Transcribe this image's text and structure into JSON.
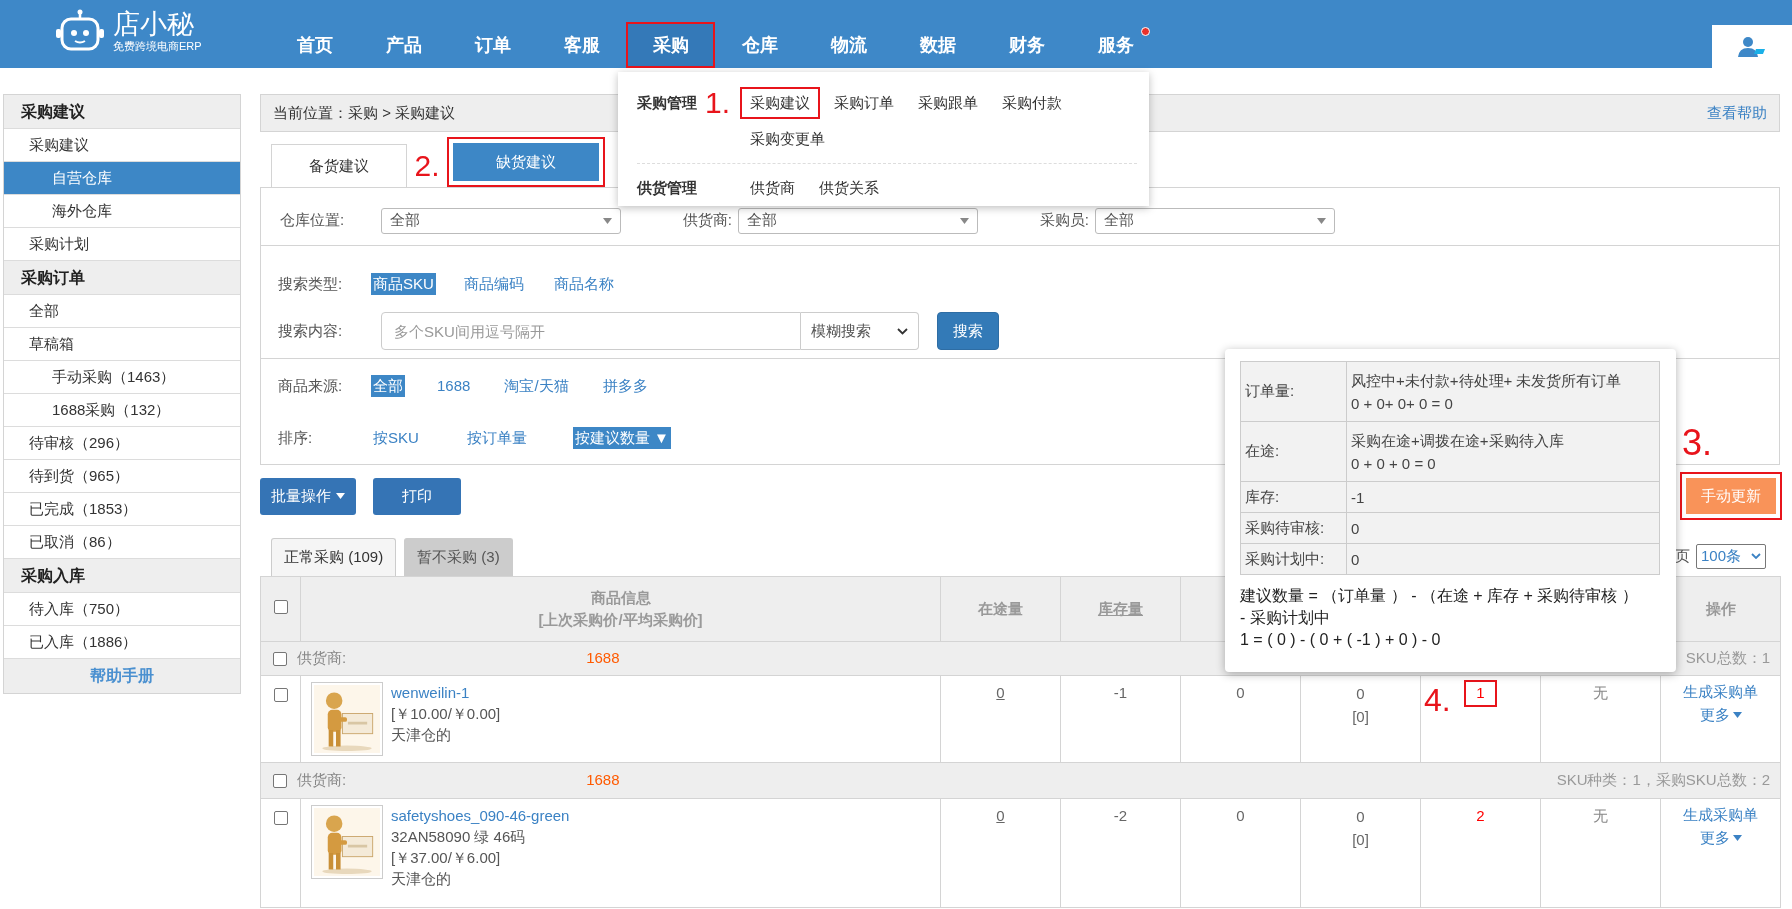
{
  "header": {
    "logo": {
      "title": "店小秘",
      "subtitle": "免费跨境电商ERP"
    },
    "nav": [
      {
        "label": "首页",
        "selected": false,
        "annotated": false,
        "notification_dot": false
      },
      {
        "label": "产品",
        "selected": false,
        "annotated": false,
        "notification_dot": false
      },
      {
        "label": "订单",
        "selected": false,
        "annotated": false,
        "notification_dot": false
      },
      {
        "label": "客服",
        "selected": false,
        "annotated": false,
        "notification_dot": false
      },
      {
        "label": "采购",
        "selected": true,
        "annotated": true,
        "notification_dot": false
      },
      {
        "label": "仓库",
        "selected": false,
        "annotated": false,
        "notification_dot": false
      },
      {
        "label": "物流",
        "selected": false,
        "annotated": false,
        "notification_dot": false
      },
      {
        "label": "数据",
        "selected": false,
        "annotated": false,
        "notification_dot": false
      },
      {
        "label": "财务",
        "selected": false,
        "annotated": false,
        "notification_dot": false
      },
      {
        "label": "服务",
        "selected": false,
        "annotated": false,
        "notification_dot": true
      }
    ]
  },
  "purchase_menu": {
    "groups": [
      {
        "title": "采购管理",
        "marker": "1.",
        "items": [
          {
            "label": "采购建议",
            "annotated": true
          },
          {
            "label": "采购订单",
            "annotated": false
          },
          {
            "label": "采购跟单",
            "annotated": false
          },
          {
            "label": "采购付款",
            "annotated": false
          },
          {
            "label": "采购变更单",
            "annotated": false
          }
        ]
      },
      {
        "title": "供货管理",
        "items": [
          {
            "label": "供货商",
            "annotated": false
          },
          {
            "label": "供货关系",
            "annotated": false
          }
        ]
      }
    ]
  },
  "sidebar": {
    "sections": [
      {
        "title": "采购建议",
        "items": [
          {
            "label": "采购建议",
            "selected": false,
            "children": [
              {
                "label": "自营仓库",
                "selected": true
              },
              {
                "label": "海外仓库",
                "selected": false
              }
            ]
          },
          {
            "label": "采购计划",
            "selected": false
          }
        ]
      },
      {
        "title": "采购订单",
        "items": [
          {
            "label": "全部",
            "selected": false
          },
          {
            "label": "草稿箱",
            "selected": false,
            "children": [
              {
                "label": "手动采购（1463）",
                "selected": false
              },
              {
                "label": "1688采购（132）",
                "selected": false
              }
            ]
          },
          {
            "label": "待审核（296）",
            "selected": false
          },
          {
            "label": "待到货（965）",
            "selected": false
          },
          {
            "label": "已完成（1853）",
            "selected": false
          },
          {
            "label": "已取消（86）",
            "selected": false
          }
        ]
      },
      {
        "title": "采购入库",
        "items": [
          {
            "label": "待入库（750）",
            "selected": false
          },
          {
            "label": "已入库（1886）",
            "selected": false
          }
        ]
      }
    ],
    "help_link": "帮助手册"
  },
  "breadcrumb": {
    "text": "当前位置：采购 > 采购建议",
    "help_link": "查看帮助"
  },
  "suggestion_tabs": [
    {
      "label": "备货建议",
      "selected": false,
      "annotated": false
    },
    {
      "label": "缺货建议",
      "selected": true,
      "annotated": true,
      "marker": "2."
    }
  ],
  "filters": {
    "selects": [
      {
        "label": "仓库位置:",
        "value": "全部"
      },
      {
        "label": "供货商:",
        "value": "全部"
      },
      {
        "label": "采购员:",
        "value": "全部"
      }
    ],
    "search_type": {
      "label": "搜索类型:",
      "options": [
        {
          "label": "商品SKU",
          "selected": true
        },
        {
          "label": "商品编码",
          "selected": false
        },
        {
          "label": "商品名称",
          "selected": false
        }
      ]
    },
    "search": {
      "label": "搜索内容:",
      "placeholder": "多个SKU间用逗号隔开",
      "mode": "模糊搜索",
      "button": "搜索"
    },
    "source": {
      "label": "商品来源:",
      "options": [
        {
          "label": "全部",
          "selected": true
        },
        {
          "label": "1688",
          "selected": false
        },
        {
          "label": "淘宝/天猫",
          "selected": false
        },
        {
          "label": "拼多多",
          "selected": false
        }
      ]
    },
    "sort": {
      "label": "排序:",
      "options": [
        {
          "label": "按SKU",
          "selected": false
        },
        {
          "label": "按订单量",
          "selected": false
        },
        {
          "label": "按建议数量 ▼",
          "selected": true
        }
      ]
    }
  },
  "toolbar": {
    "batch": "批量操作",
    "print": "打印",
    "refresh": {
      "label": "手动更新",
      "annotated": true,
      "marker": "3."
    }
  },
  "list_tabs": [
    {
      "label": "正常采购 (109)",
      "selected": true
    },
    {
      "label": "暂不采购 (3)",
      "selected": false
    }
  ],
  "page_size": {
    "label": "页",
    "value": "100条"
  },
  "table": {
    "select_all_checked": false,
    "columns": {
      "product": {
        "label": "商品信息",
        "sublabel": "[上次采购价/平均采购价]",
        "sortable": false
      },
      "in_transit": {
        "label": "在途量",
        "sortable": false
      },
      "stock": {
        "label": "库存量",
        "sortable": true
      },
      "action": {
        "label": "操作",
        "sortable": false
      }
    },
    "groups": [
      {
        "checked": false,
        "supplier_label": "供货商:",
        "supplier": "1688",
        "summary": "SKU总数：1",
        "rows": [
          {
            "checked": false,
            "kind": "picture",
            "sku": "wenweilin-1",
            "details": [
              "[￥10.00/￥0.00]",
              "天津仓的"
            ],
            "in_transit": "0",
            "stock": "-1",
            "column_4": "0",
            "column_5": [
              "0",
              "[0]"
            ],
            "suggested": {
              "value": "1",
              "annotated": true,
              "marker": "4."
            },
            "column_7": "无",
            "actions": [
              {
                "label": "生成采购单",
                "dropdown": false
              },
              {
                "label": "更多",
                "dropdown": true
              }
            ]
          }
        ]
      },
      {
        "checked": false,
        "supplier_label": "供货商:",
        "supplier": "1688",
        "summary": "SKU种类：1，采购SKU总数：2",
        "rows": [
          {
            "checked": false,
            "kind": "picture",
            "sku": "safetyshoes_090-46-green",
            "details": [
              "32AN58090 绿 46码",
              "[￥37.00/￥6.00]",
              "天津仓的"
            ],
            "in_transit": "0",
            "stock": "-2",
            "column_4": "0",
            "column_5": [
              "0",
              "[0]"
            ],
            "suggested": {
              "value": "2",
              "annotated": false
            },
            "column_7": "无",
            "actions": [
              {
                "label": "生成采购单",
                "dropdown": false
              },
              {
                "label": "更多",
                "dropdown": true
              }
            ]
          }
        ]
      }
    ]
  },
  "tooltip": {
    "rows": [
      {
        "label": "订单量:",
        "lines": [
          "风控中+未付款+待处理+ 未发货所有订单",
          "0 + 0+ 0+ 0 = 0"
        ]
      },
      {
        "label": "在途:",
        "lines": [
          "采购在途+调拨在途+采购待入库",
          "0 + 0 + 0 = 0"
        ]
      },
      {
        "label": "库存:",
        "lines": [
          "-1"
        ]
      },
      {
        "label": "采购待审核:",
        "lines": [
          "0"
        ]
      },
      {
        "label": "采购计划中:",
        "lines": [
          "0"
        ]
      }
    ],
    "formula": [
      "建议数量 = （订单量 ） - （在途 + 库存 + 采购待审核 ）",
      "- 采购计划中",
      "1 = ( 0 ) - ( 0 + ( -1 ) + 0 ) - 0"
    ]
  }
}
